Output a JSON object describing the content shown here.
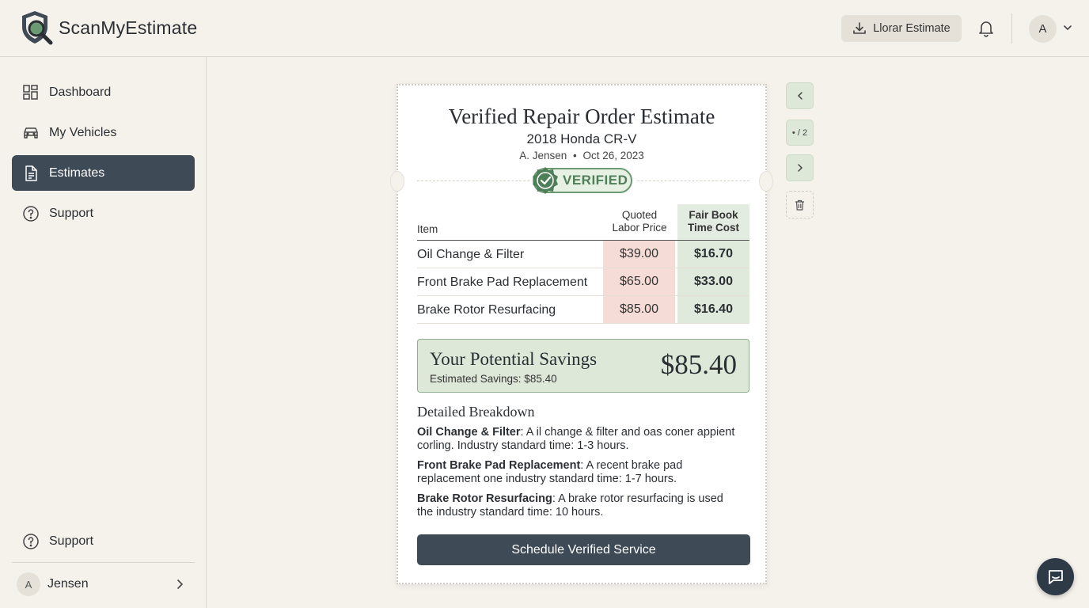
{
  "brand": {
    "name": "ScanMyEstimate"
  },
  "header": {
    "download_label": "Llorar Estimate",
    "avatar_initial": "A"
  },
  "sidebar": {
    "items": [
      {
        "label": "Dashboard",
        "icon": "dashboard-icon"
      },
      {
        "label": "My Vehicles",
        "icon": "car-icon"
      },
      {
        "label": "Estimates",
        "icon": "document-icon",
        "active": true
      },
      {
        "label": "Support",
        "icon": "help-circle-icon"
      }
    ],
    "bottom_support_label": "Support",
    "user": {
      "initial": "A",
      "name": "Jensen"
    }
  },
  "estimate": {
    "title": "Verified Repair Order Estimate",
    "vehicle": "2018 Honda CR-V",
    "customer": "A. Jensen",
    "separator": "•",
    "date": "Oct 26, 2023",
    "badge": "VERIFIED",
    "table": {
      "headers": {
        "item": "Item",
        "quoted_line1": "Quoted",
        "quoted_line2": "Labor Price",
        "fair_line1": "Fair Book",
        "fair_line2": "Time Cost"
      },
      "rows": [
        {
          "item": "Oil Change & Filter",
          "quoted": "$39.00",
          "fair": "$16.70"
        },
        {
          "item": "Front Brake Pad Replacement",
          "quoted": "$65.00",
          "fair": "$33.00"
        },
        {
          "item": "Brake Rotor Resurfacing",
          "quoted": "$85.00",
          "fair": "$16.40"
        }
      ]
    },
    "savings": {
      "title": "Your Potential Savings",
      "subtitle": "Estimated Savings: $85.40",
      "amount": "$85.40"
    },
    "breakdown": {
      "title": "Detailed Breakdown",
      "items": [
        {
          "name": "Oil Change & Filter",
          "text": ": A il change & filter and oas coner appient corling. Industry standard time: 1-3 hours."
        },
        {
          "name": "Front Brake Pad Replacement",
          "text": ": A recent brake pad replacement one industry standard time: 1-7 hours."
        },
        {
          "name": "Brake Rotor Resurfacing",
          "text": ": A brake rotor resurfacing is used the industry standard time: 10 hours."
        }
      ]
    },
    "schedule_label": "Schedule Verified Service"
  },
  "pager": {
    "label": "• / 2"
  },
  "colors": {
    "accent_dark": "#3e4a55",
    "verified_green": "#4f7f58",
    "quoted_red_bg": "#f5dcd6",
    "fair_green_bg": "#dfe9dc"
  }
}
